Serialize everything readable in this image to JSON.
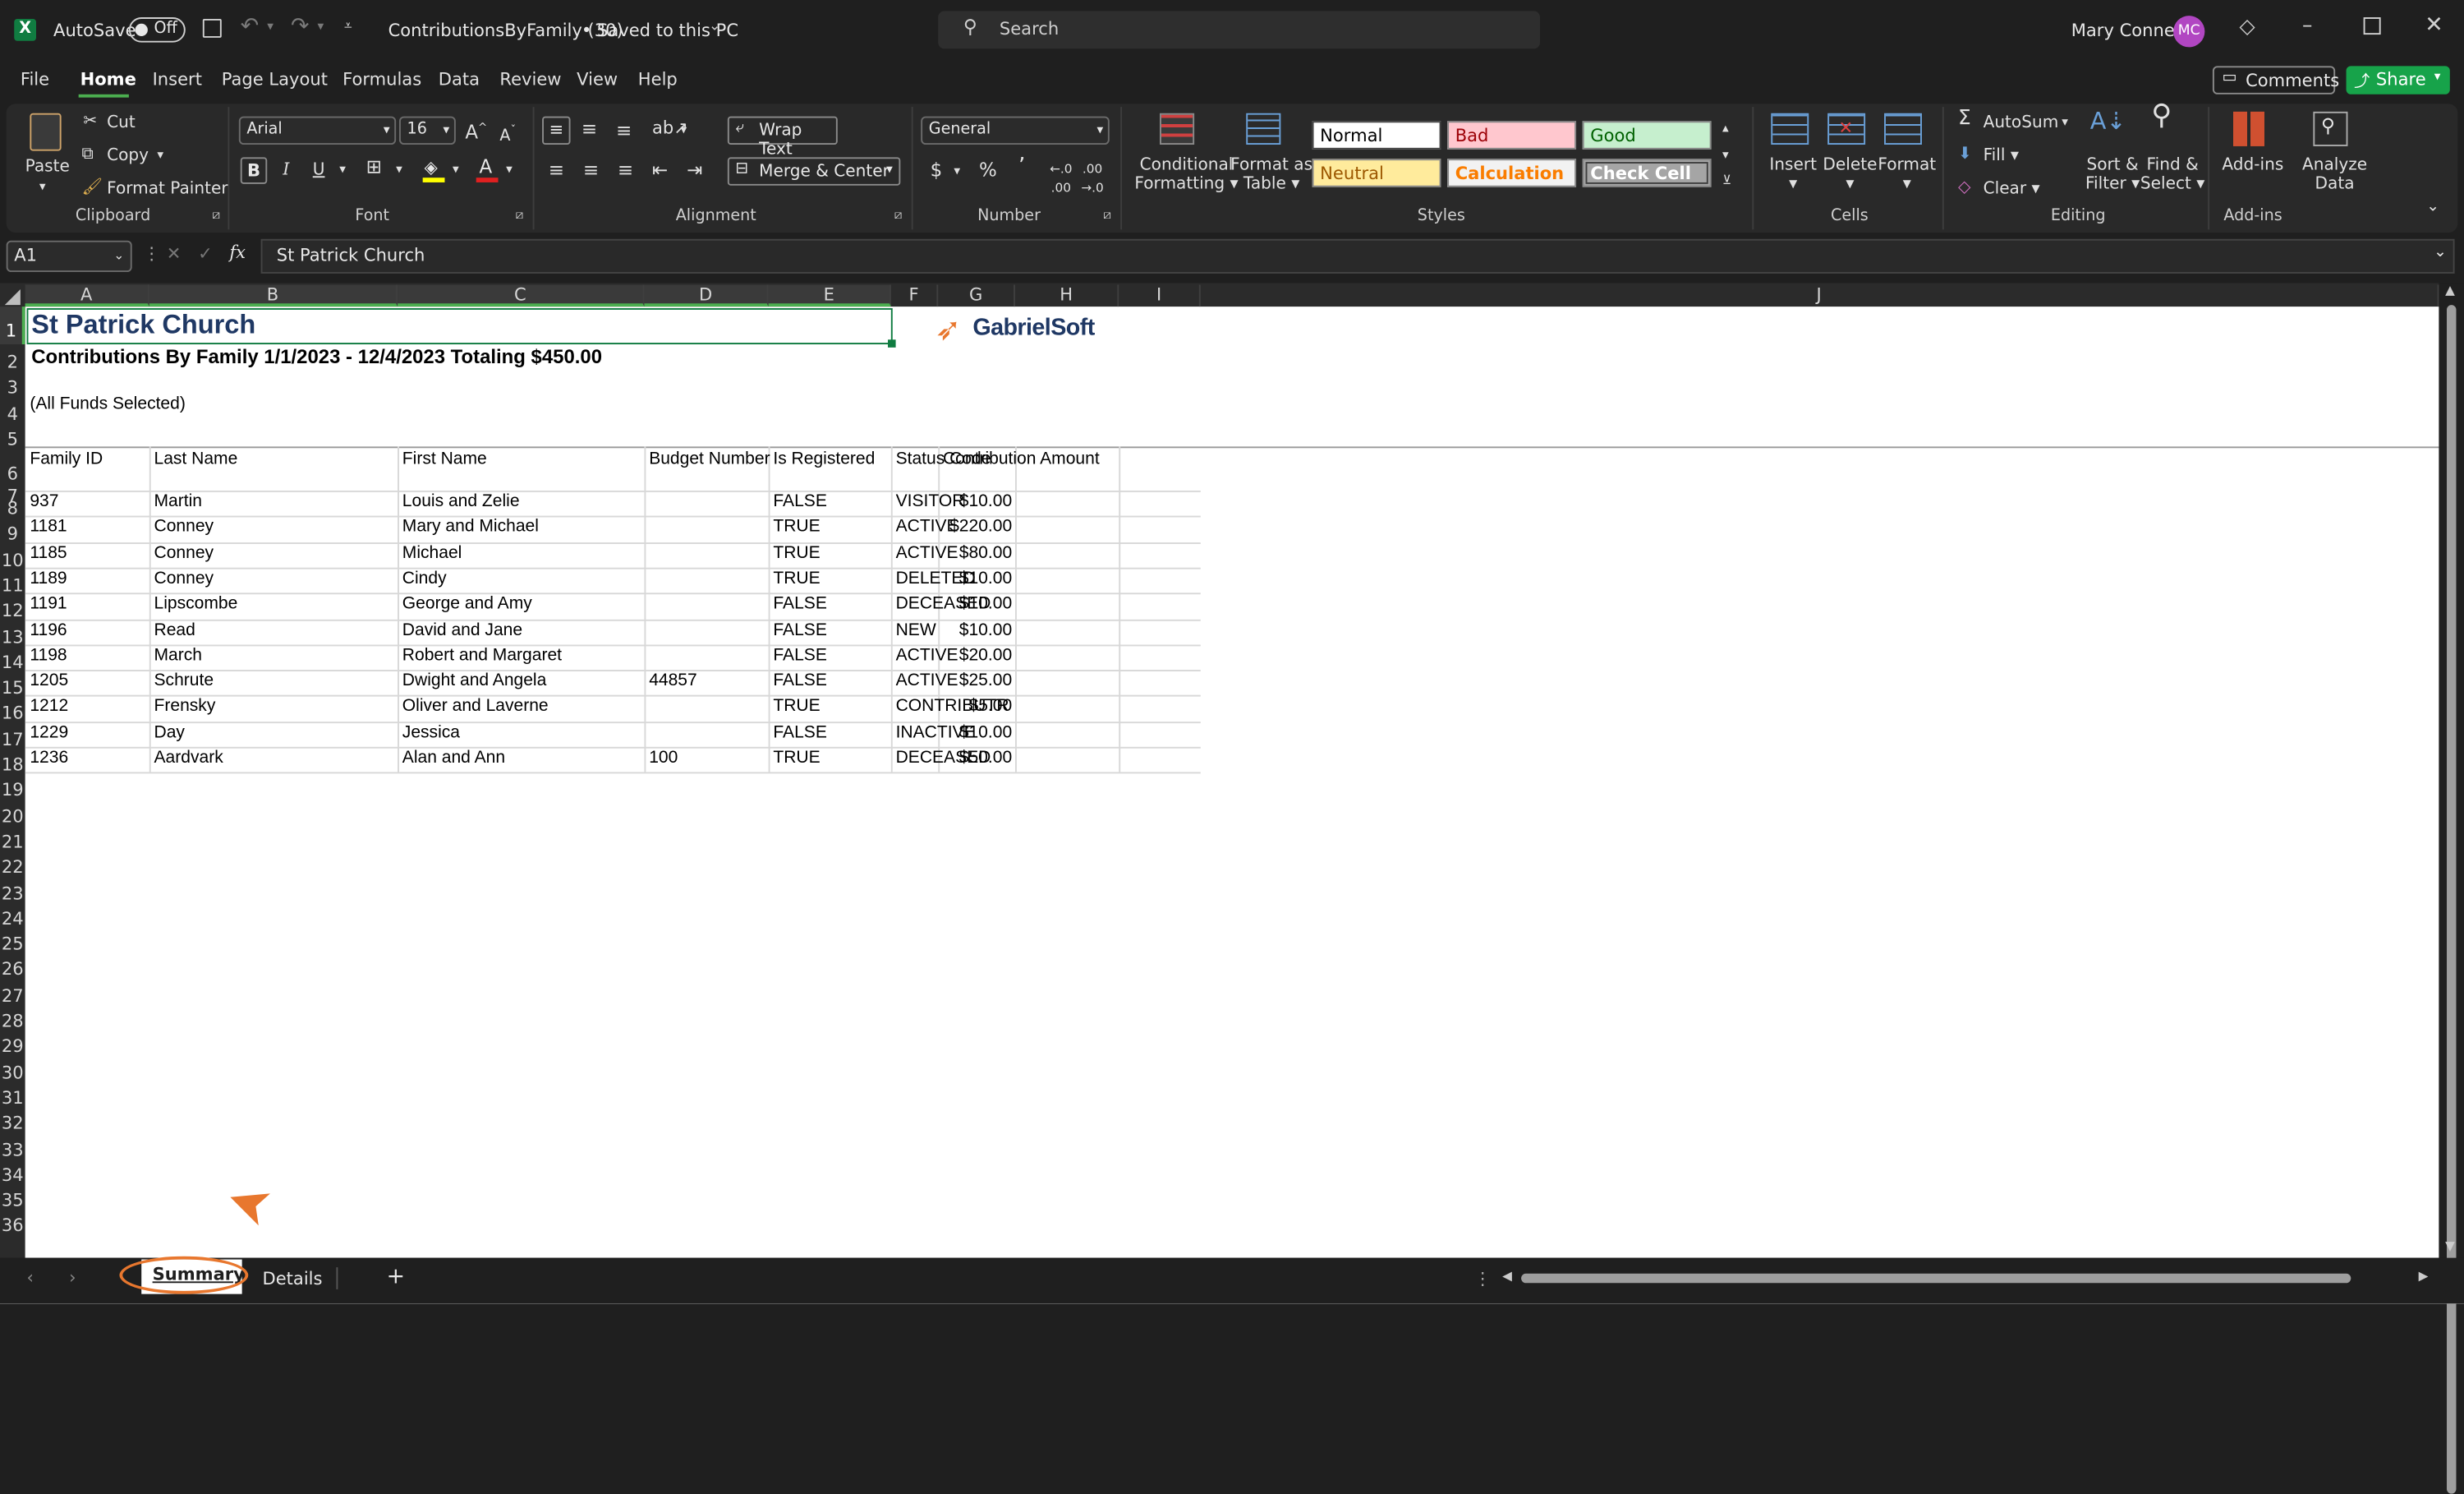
{
  "titlebar": {
    "autosave_label": "AutoSave",
    "autosave_state": "Off",
    "doc_title": "ContributionsByFamily (30)",
    "saved_status": "• Saved to this PC",
    "search_placeholder": "Search",
    "user_name": "Mary Conney",
    "user_initials": "MC"
  },
  "menu": {
    "tabs": [
      "File",
      "Home",
      "Insert",
      "Page Layout",
      "Formulas",
      "Data",
      "Review",
      "View",
      "Help"
    ],
    "active": "Home",
    "comments_label": "Comments",
    "share_label": "Share"
  },
  "ribbon": {
    "clipboard": {
      "paste": "Paste",
      "cut": "Cut",
      "copy": "Copy",
      "format_painter": "Format Painter",
      "group": "Clipboard"
    },
    "font": {
      "name": "Arial",
      "size": "16",
      "bold": "B",
      "italic": "I",
      "underline": "U",
      "group": "Font"
    },
    "alignment": {
      "wrap": "Wrap Text",
      "merge": "Merge & Center",
      "group": "Alignment"
    },
    "number": {
      "format": "General",
      "currency": "$",
      "percent": "%",
      "comma": "’",
      "group": "Number"
    },
    "styles": {
      "conditional_1": "Conditional",
      "conditional_2": "Formatting",
      "format_table_1": "Format as",
      "format_table_2": "Table",
      "normal": "Normal",
      "bad": "Bad",
      "good": "Good",
      "neutral": "Neutral",
      "calculation": "Calculation",
      "check_cell": "Check Cell",
      "group": "Styles"
    },
    "cells": {
      "insert": "Insert",
      "delete": "Delete",
      "format": "Format",
      "group": "Cells"
    },
    "editing": {
      "autosum": "AutoSum",
      "fill": "Fill",
      "clear": "Clear",
      "sort_1": "Sort &",
      "sort_2": "Filter",
      "find_1": "Find &",
      "find_2": "Select",
      "group": "Editing"
    },
    "addins": {
      "addins": "Add-ins",
      "analyze_1": "Analyze",
      "analyze_2": "Data",
      "group": "Add-ins"
    }
  },
  "formula_bar": {
    "name_box": "A1",
    "formula": "St Patrick Church"
  },
  "columns": [
    "A",
    "B",
    "C",
    "D",
    "E",
    "F",
    "G",
    "H",
    "I",
    "J"
  ],
  "rows": [
    "1",
    "2",
    "3",
    "4",
    "5",
    "6",
    "7",
    "8",
    "9",
    "10",
    "11",
    "12",
    "13",
    "14",
    "15",
    "16",
    "17",
    "18",
    "19",
    "20",
    "21",
    "22",
    "23",
    "24",
    "25",
    "26",
    "27",
    "28",
    "29",
    "30",
    "31",
    "32",
    "33",
    "34",
    "35",
    "36"
  ],
  "sheet": {
    "title": "St Patrick Church",
    "subtitle": "Contributions By Family 1/1/2023 - 12/4/2023 Totaling $450.00",
    "funds": "(All Funds Selected)",
    "logo_text": "GabrielSoft",
    "headers": [
      "Family ID",
      "Last Name",
      "First Name",
      "Budget Number",
      "Is Registered",
      "Status Code",
      "Contribution Amount"
    ],
    "records": [
      [
        "937",
        "Martin",
        "Louis and Zelie",
        "",
        "FALSE",
        "VISITOR",
        "$10.00"
      ],
      [
        "1181",
        "Conney",
        "Mary and Michael",
        "",
        "TRUE",
        "ACTIVE",
        "$220.00"
      ],
      [
        "1185",
        "Conney",
        "Michael",
        "",
        "TRUE",
        "ACTIVE",
        "$80.00"
      ],
      [
        "1189",
        "Conney",
        "Cindy",
        "",
        "TRUE",
        "DELETED",
        "$10.00"
      ],
      [
        "1191",
        "Lipscombe",
        "George and Amy",
        "",
        "FALSE",
        "DECEASED",
        "$10.00"
      ],
      [
        "1196",
        "Read",
        "David and Jane",
        "",
        "FALSE",
        "NEW",
        "$10.00"
      ],
      [
        "1198",
        "March",
        "Robert and Margaret",
        "",
        "FALSE",
        "ACTIVE",
        "$20.00"
      ],
      [
        "1205",
        "Schrute",
        "Dwight and Angela",
        "44857",
        "FALSE",
        "ACTIVE",
        "$25.00"
      ],
      [
        "1212",
        "Frensky",
        "Oliver and Laverne",
        "",
        "TRUE",
        "CONTRIBUTR",
        "$5.00"
      ],
      [
        "1229",
        "Day",
        "Jessica",
        "",
        "FALSE",
        "INACTIVE",
        "$10.00"
      ],
      [
        "1236",
        "Aardvark",
        "Alan and Ann",
        "100",
        "TRUE",
        "DECEASED",
        "$50.00"
      ]
    ]
  },
  "sheet_tabs": {
    "summary": "Summary",
    "details": "Details",
    "add": "+"
  },
  "colors": {
    "excel_green": "#107c41",
    "title_blue": "#1f3864",
    "share_green": "#17a34a",
    "annotation_orange": "#e8772e"
  }
}
